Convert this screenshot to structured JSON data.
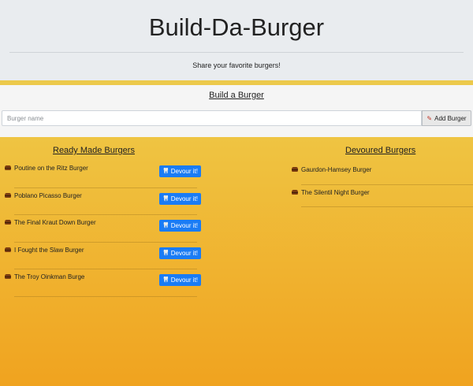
{
  "header": {
    "title": "Build-Da-Burger",
    "subtitle": "Share your favorite burgers!"
  },
  "build": {
    "heading": "Build a Burger",
    "input_placeholder": "Burger name",
    "input_value": "",
    "add_button_label": "Add Burger",
    "add_icon": "pencil-icon"
  },
  "ready": {
    "heading": "Ready Made Burgers",
    "button_label": "Devour it!",
    "button_icon": "tooth-icon",
    "items": [
      {
        "name": "Poutine on the Ritz Burger"
      },
      {
        "name": "Poblano Picasso Burger"
      },
      {
        "name": "The Final Kraut Down Burger"
      },
      {
        "name": "I Fought the Slaw Burger"
      },
      {
        "name": "The Troy Oinkman Burge"
      }
    ]
  },
  "devoured": {
    "heading": "Devoured Burgers",
    "items": [
      {
        "name": "Gaurdon-Hamsey Burger"
      },
      {
        "name": "The Silentil Night Burger"
      }
    ]
  },
  "colors": {
    "accent_bar": "#ecc94b",
    "button_blue": "#1a7cf5",
    "gradient_top": "#efc442",
    "gradient_bottom": "#f0a31f"
  }
}
